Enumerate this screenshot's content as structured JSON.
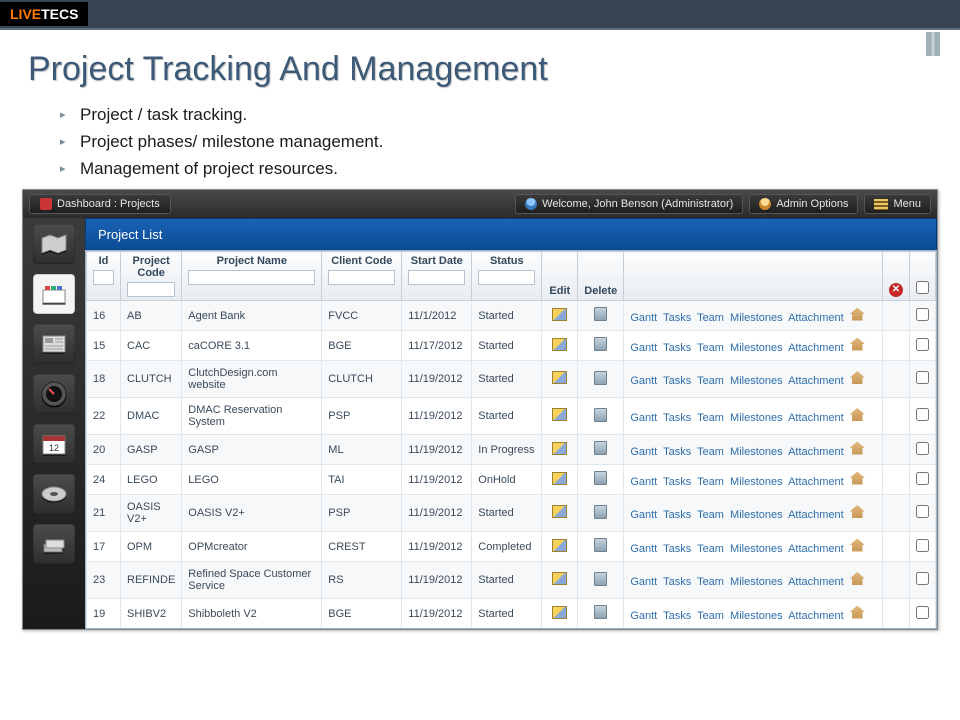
{
  "logo": {
    "part1": "LIVE",
    "part2": "TECS"
  },
  "slide": {
    "title": "Project Tracking And Management",
    "bullets": [
      "Project / task tracking.",
      "Project phases/ milestone management.",
      "Management of project resources."
    ]
  },
  "topbar": {
    "breadcrumb": "Dashboard : Projects",
    "welcome": "Welcome, John Benson (Administrator)",
    "admin_options": "Admin Options",
    "menu": "Menu"
  },
  "panel": {
    "title": "Project List"
  },
  "columns": {
    "id": "Id",
    "project_code": "Project Code",
    "project_name": "Project Name",
    "client_code": "Client Code",
    "start_date": "Start Date",
    "status": "Status",
    "edit": "Edit",
    "delete": "Delete"
  },
  "row_links": {
    "gantt": "Gantt",
    "tasks": "Tasks",
    "team": "Team",
    "milestones": "Milestones",
    "attachment": "Attachment"
  },
  "rows": [
    {
      "id": "16",
      "code": "AB",
      "name": "Agent Bank",
      "client": "FVCC",
      "date": "11/1/2012",
      "status": "Started"
    },
    {
      "id": "15",
      "code": "CAC",
      "name": "caCORE 3.1",
      "client": "BGE",
      "date": "11/17/2012",
      "status": "Started"
    },
    {
      "id": "18",
      "code": "CLUTCH",
      "name": "ClutchDesign.com website",
      "client": "CLUTCH",
      "date": "11/19/2012",
      "status": "Started"
    },
    {
      "id": "22",
      "code": "DMAC",
      "name": "DMAC Reservation System",
      "client": "PSP",
      "date": "11/19/2012",
      "status": "Started"
    },
    {
      "id": "20",
      "code": "GASP",
      "name": "GASP",
      "client": "ML",
      "date": "11/19/2012",
      "status": "In Progress"
    },
    {
      "id": "24",
      "code": "LEGO",
      "name": "LEGO",
      "client": "TAI",
      "date": "11/19/2012",
      "status": "OnHold"
    },
    {
      "id": "21",
      "code": "OASIS V2+",
      "name": "OASIS V2+",
      "client": "PSP",
      "date": "11/19/2012",
      "status": "Started"
    },
    {
      "id": "17",
      "code": "OPM",
      "name": "OPMcreator",
      "client": "CREST",
      "date": "11/19/2012",
      "status": "Completed"
    },
    {
      "id": "23",
      "code": "REFINDE",
      "name": "Refined Space Customer Service",
      "client": "RS",
      "date": "11/19/2012",
      "status": "Started"
    },
    {
      "id": "19",
      "code": "SHIBV2",
      "name": "Shibboleth V2",
      "client": "BGE",
      "date": "11/19/2012",
      "status": "Started"
    }
  ]
}
